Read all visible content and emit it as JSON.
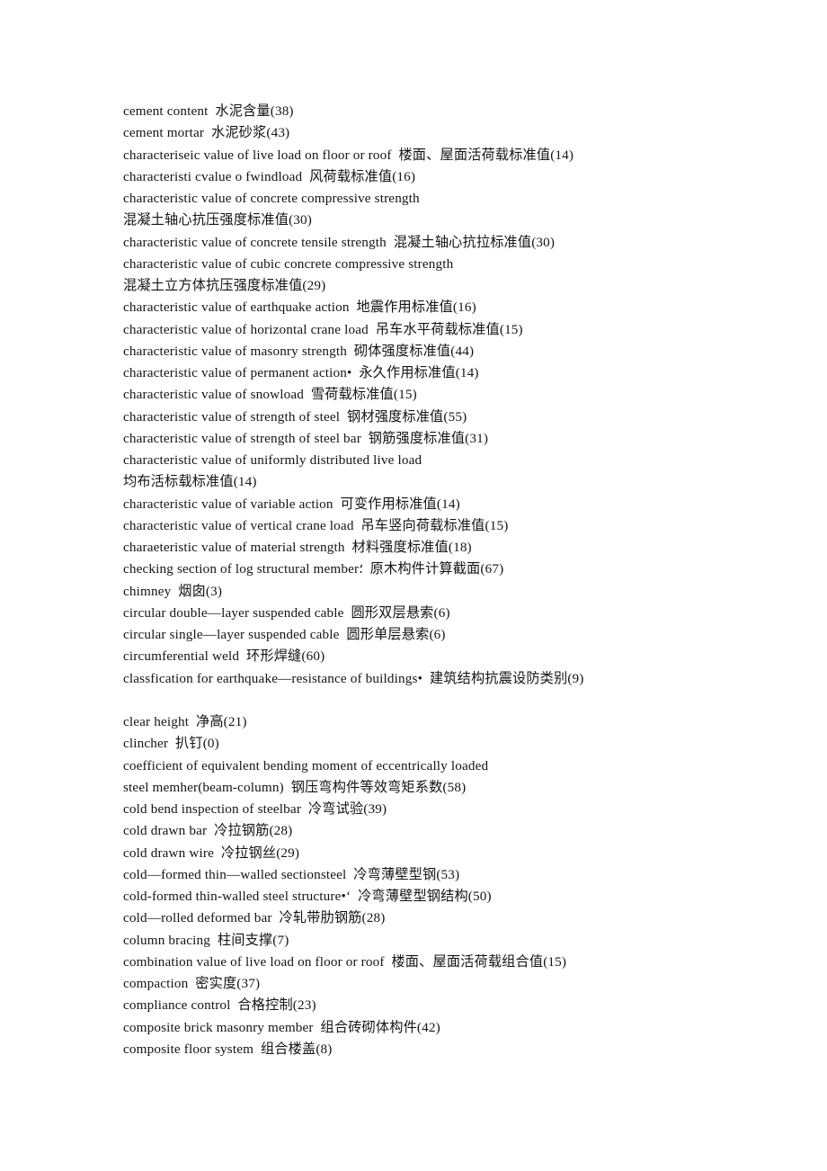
{
  "page": {
    "background_color": "#ffffff",
    "text_color": "#141414",
    "type": "bilingual-glossary-page",
    "language_pair": "English-Chinese"
  },
  "entries": [
    {
      "text": "cement content  水泥含量(38)"
    },
    {
      "text": "cement mortar  水泥砂浆(43)"
    },
    {
      "text": "characteriseic value of live load on floor or roof  楼面、屋面活荷载标准值(14)"
    },
    {
      "text": "characteristi cvalue o fwindload  风荷载标准值(16)"
    },
    {
      "text": "characteristic value of concrete compressive strength"
    },
    {
      "text": "混凝土轴心抗压强度标准值(30)"
    },
    {
      "text": "characteristic value of concrete tensile strength  混凝土轴心抗拉标准值(30)"
    },
    {
      "text": "characteristic value of cubic concrete compressive strength"
    },
    {
      "text": "混凝土立方体抗压强度标准值(29)"
    },
    {
      "text": "characteristic value of earthquake action  地震作用标准值(16)"
    },
    {
      "text": "characteristic value of horizontal crane load  吊车水平荷载标准值(15)"
    },
    {
      "text": "characteristic value of masonry strength  砌体强度标准值(44)"
    },
    {
      "text": "characteristic value of permanent action•  永久作用标准值(14)"
    },
    {
      "text": "characteristic value of snowload  雪荷载标准值(15)"
    },
    {
      "text": "characteristic value of strength of steel  钢材强度标准值(55)"
    },
    {
      "text": "characteristic value of strength of steel bar  钢筋强度标准值(31)"
    },
    {
      "text": "characteristic value of uniformly distributed live load"
    },
    {
      "text": "均布活标载标准值(14)"
    },
    {
      "text": "characteristic value of variable action  可变作用标准值(14)"
    },
    {
      "text": "characteristic value of vertical crane load  吊车竖向荷载标准值(15)"
    },
    {
      "text": "charaeteristic value of material strength  材料强度标准值(18)"
    },
    {
      "text": "checking section of log structural member؛  原木构件计算截面(67)"
    },
    {
      "text": "chimney  烟囱(3)"
    },
    {
      "text": "circular double—layer suspended cable  圆形双层悬索(6)"
    },
    {
      "text": "circular single—layer suspended cable  圆形单层悬索(6)"
    },
    {
      "text": "circumferential weld  环形焊缝(60)"
    },
    {
      "text": "classfication for earthquake—resistance of buildings•  建筑结构抗震设防类别(9)"
    },
    {
      "text": "",
      "blank": true
    },
    {
      "text": "clear height  净高(21)"
    },
    {
      "text": "clincher  扒钉(0)"
    },
    {
      "text": "coefficient of equivalent bending moment of eccentrically loaded"
    },
    {
      "text": "steel memher(beam-column)  钢压弯构件等效弯矩系数(58)"
    },
    {
      "text": "cold bend inspection of steelbar  冷弯试验(39)"
    },
    {
      "text": "cold drawn bar  冷拉钢筋(28)"
    },
    {
      "text": "cold drawn wire  冷拉钢丝(29)"
    },
    {
      "text": "cold—formed thin—walled sectionsteel  冷弯薄壁型钢(53)"
    },
    {
      "text": "cold-formed thin-walled steel structure•‘  冷弯薄壁型钢结构(50)"
    },
    {
      "text": "cold—rolled deformed bar  冷轧带肋钢筋(28)"
    },
    {
      "text": "column bracing  柱间支撑(7)"
    },
    {
      "text": "combination value of live load on floor or roof  楼面、屋面活荷载组合值(15)"
    },
    {
      "text": "compaction  密实度(37)"
    },
    {
      "text": "compliance control  合格控制(23)"
    },
    {
      "text": "composite brick masonry member  组合砖砌体构件(42)"
    },
    {
      "text": "composite floor system  组合楼盖(8)"
    }
  ]
}
